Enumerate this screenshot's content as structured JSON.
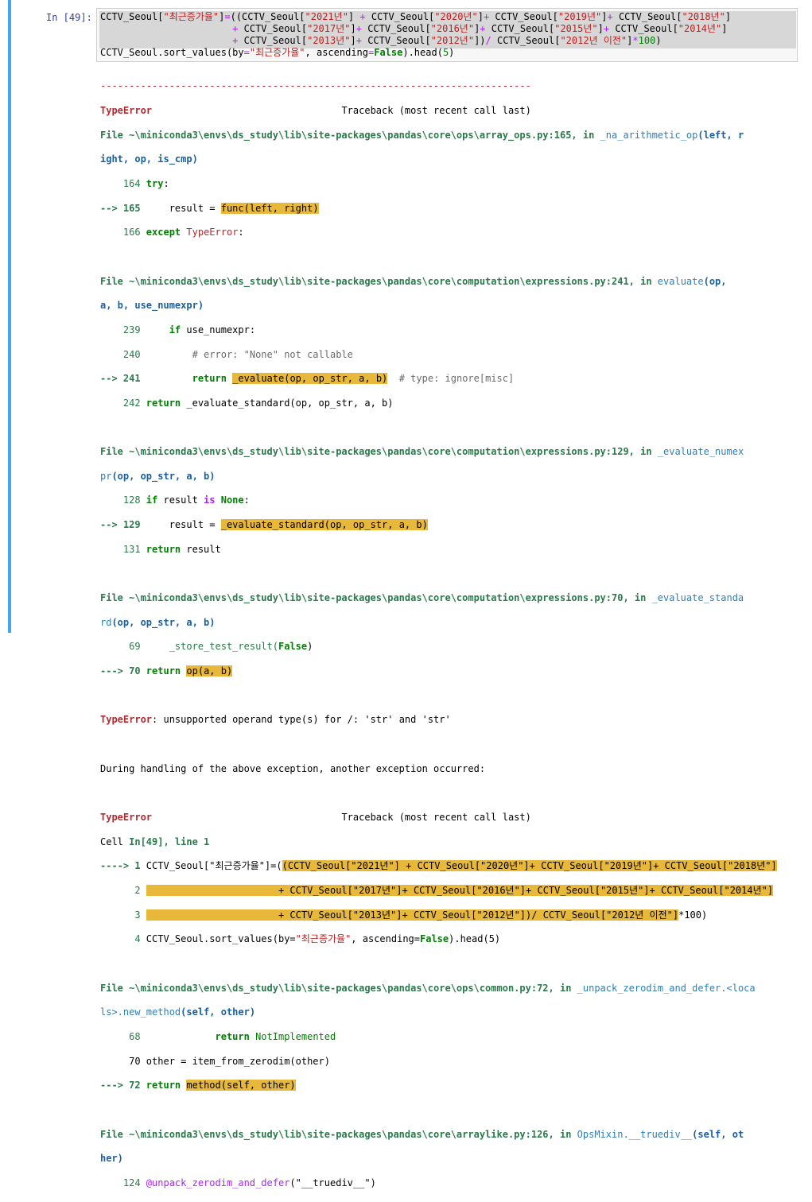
{
  "cell": {
    "prompt": "In [49]:",
    "input_lines": [
      "CCTV_Seoul[\"최근증가율\"]=((CCTV_Seoul[\"2021년\"] + CCTV_Seoul[\"2020년\"]+ CCTV_Seoul[\"2019년\"]+ CCTV_Seoul[\"2018년\"]",
      "                       + CCTV_Seoul[\"2017년\"]+ CCTV_Seoul[\"2016년\"]+ CCTV_Seoul[\"2015년\"]+ CCTV_Seoul[\"2014년\"]",
      "                       + CCTV_Seoul[\"2013년\"]+ CCTV_Seoul[\"2012년\"])/ CCTV_Seoul[\"2012년 이전\"]*100)",
      "CCTV_Seoul.sort_values(by=\"최근증가율\", ascending=False).head(5)"
    ]
  },
  "traceback": {
    "dashes": "---------------------------------------------------------------------------",
    "error_name": "TypeError",
    "tb_header": "                                 Traceback (most recent call last)",
    "frame1_file": "File ~\\miniconda3\\envs\\ds_study\\lib\\site-packages\\pandas\\core\\ops\\array_ops.py:165, in ",
    "frame1_fn": "_na_arithmetic_op",
    "frame1_args_a": "(left, r",
    "frame1_args_b": "ight, op, is_cmp)",
    "frame1_l164": "    164 ",
    "frame1_l164_kw": "try",
    "frame1_l165_arrow": "--> 165",
    "frame1_l165_pre": "     result = ",
    "frame1_l165_hl": "func(left, right)",
    "frame1_l166": "    166 ",
    "frame1_l166_kw": "except",
    "frame1_l166_err": "TypeError",
    "frame2_file": "File ~\\miniconda3\\envs\\ds_study\\lib\\site-packages\\pandas\\core\\computation\\expressions.py:241, in ",
    "frame2_fn": "evaluate",
    "frame2_args_a": "(op,",
    "frame2_args_b": "a, b, use_numexpr)",
    "frame2_l239": "    239     ",
    "frame2_l239_kw": "if",
    "frame2_l239_rest": " use_numexpr:",
    "frame2_l240": "    240         ",
    "frame2_l240_cmt": "# error: \"None\" not callable",
    "frame2_l241_arrow": "--> 241",
    "frame2_l241_pre": "         ",
    "frame2_l241_kw": "return",
    "frame2_l241_hl": "_evaluate(op, op_str, a, b)",
    "frame2_l241_cmt": "  # type: ignore[misc]",
    "frame2_l242": "    242 ",
    "frame2_l242_kw": "return",
    "frame2_l242_rest": " _evaluate_standard(op, op_str, a, b)",
    "frame3_file": "File ~\\miniconda3\\envs\\ds_study\\lib\\site-packages\\pandas\\core\\computation\\expressions.py:129, in ",
    "frame3_fn_a": "_evaluate_numex",
    "frame3_fn_b": "pr",
    "frame3_args": "(op, op_str, a, b)",
    "frame3_l128": "    128 ",
    "frame3_l128_kw": "if",
    "frame3_l128_mid": " result ",
    "frame3_l128_is": "is",
    "frame3_l128_none": "None",
    "frame3_l129_arrow": "--> 129",
    "frame3_l129_pre": "     result = ",
    "frame3_l129_hl": "_evaluate_standard(op, op_str, a, b)",
    "frame3_l131": "    131 ",
    "frame3_l131_kw": "return",
    "frame3_l131_rest": " result",
    "frame4_file": "File ~\\miniconda3\\envs\\ds_study\\lib\\site-packages\\pandas\\core\\computation\\expressions.py:70, in ",
    "frame4_fn_a": "_evaluate_standa",
    "frame4_fn_b": "rd",
    "frame4_args": "(op, op_str, a, b)",
    "frame4_l69": "     69     _store_test_result(",
    "frame4_l69_false": "False",
    "frame4_l70_arrow": "---> 70 ",
    "frame4_l70_kw": "return",
    "frame4_l70_hl": "op(a, b)",
    "error_msg": ": unsupported operand type(s) for /: 'str' and 'str'",
    "during": "During handling of the above exception, another exception occurred:",
    "cell_line_a": "Cell ",
    "cell_line_b": "In[49], line 1",
    "c1_arrow": "----> 1 ",
    "c1_pre": "CCTV_Seoul[\"최근증가율\"]=(",
    "c1_hl": "(CCTV_Seoul[\"2021년\"] + CCTV_Seoul[\"2020년\"]+ CCTV_Seoul[\"2019년\"]+ CCTV_Seoul[\"2018년\"]",
    "c2_num": "      2 ",
    "c2_hl": "                       + CCTV_Seoul[\"2017년\"]+ CCTV_Seoul[\"2016년\"]+ CCTV_Seoul[\"2015년\"]+ CCTV_Seoul[\"2014년\"]",
    "c3_num": "      3 ",
    "c3_hl": "                       + CCTV_Seoul[\"2013년\"]+ CCTV_Seoul[\"2012년\"])/ CCTV_Seoul[\"2012년 이전\"]",
    "c3_rest": "*100)",
    "c4_num": "      4 ",
    "c4_pre": "CCTV_Seoul.sort_values(by=",
    "c4_str": "\"최근증가율\"",
    "c4_mid": ", ascending=",
    "c4_false": "False",
    "c4_rest": ").head(5)",
    "frame5_file": "File ~\\miniconda3\\envs\\ds_study\\lib\\site-packages\\pandas\\core\\ops\\common.py:72, in ",
    "frame5_fn_a": "_unpack_zerodim_and_defer.<loca",
    "frame5_fn_b": "ls>.new_method",
    "frame5_args": "(self, other)",
    "frame5_l68": "     68             ",
    "frame5_l68_kw": "return",
    "frame5_l68_rest": " NotImplemented",
    "frame5_l70": "     70 other = item_from_zerodim(other)",
    "frame5_l72_arrow": "---> 72 ",
    "frame5_l72_kw": "return",
    "frame5_l72_hl": "method(self, other)",
    "frame6_file": "File ~\\miniconda3\\envs\\ds_study\\lib\\site-packages\\pandas\\core\\arraylike.py:126, in ",
    "frame6_fn": "OpsMixin.__truediv__",
    "frame6_args_a": "(self, ot",
    "frame6_args_b": "her)",
    "frame6_l124": "    124 ",
    "frame6_l124_deco": "@unpack_zerodim_and_defer",
    "frame6_l124_rest": "(\"__truediv__\")"
  }
}
